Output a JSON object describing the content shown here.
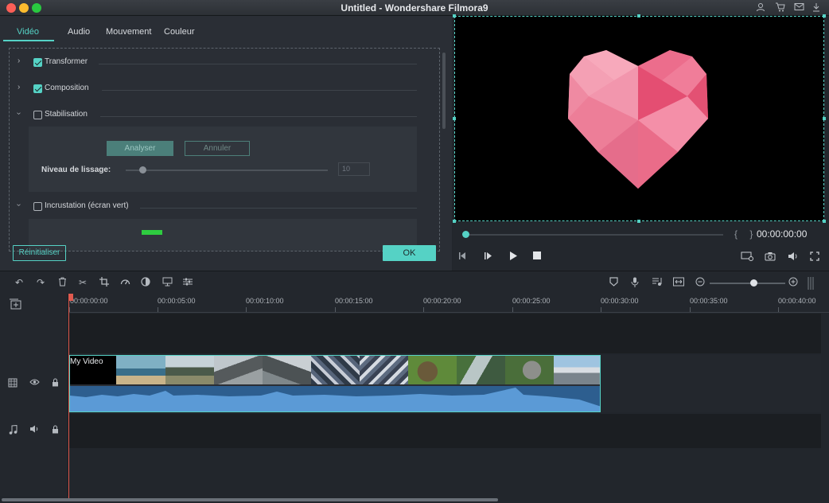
{
  "window": {
    "title": "Untitled - Wondershare Filmora9"
  },
  "tabs": [
    {
      "label": "Vidéo",
      "active": true
    },
    {
      "label": "Audio",
      "active": false
    },
    {
      "label": "Mouvement",
      "active": false
    },
    {
      "label": "Couleur",
      "active": false
    }
  ],
  "sections": [
    {
      "label": "Transformer",
      "checked": true,
      "expanded": false
    },
    {
      "label": "Composition",
      "checked": true,
      "expanded": false
    },
    {
      "label": "Stabilisation",
      "checked": false,
      "expanded": true
    },
    {
      "label": "Incrustation (écran vert)",
      "checked": false,
      "expanded": true
    }
  ],
  "stabilisation": {
    "analyze_label": "Analyser",
    "cancel_label": "Annuler",
    "smoothing_label": "Niveau de lissage:",
    "smoothing_value": "10"
  },
  "buttons": {
    "reset": "Réinitialiser",
    "ok": "OK"
  },
  "player": {
    "timecode": "00:00:00:00",
    "brackets": "{ }"
  },
  "timeline": {
    "ruler": [
      "00:00:00:00",
      "00:00:05:00",
      "00:00:10:00",
      "00:00:15:00",
      "00:00:20:00",
      "00:00:25:00",
      "00:00:30:00",
      "00:00:35:00",
      "00:00:40:00"
    ],
    "clip_name": "My Video",
    "zoom_level": 0.55
  },
  "colors": {
    "accent": "#55d2c5",
    "heart": "#e8577a",
    "playhead": "#e05a4f",
    "waveform": "#5b9ad6"
  }
}
